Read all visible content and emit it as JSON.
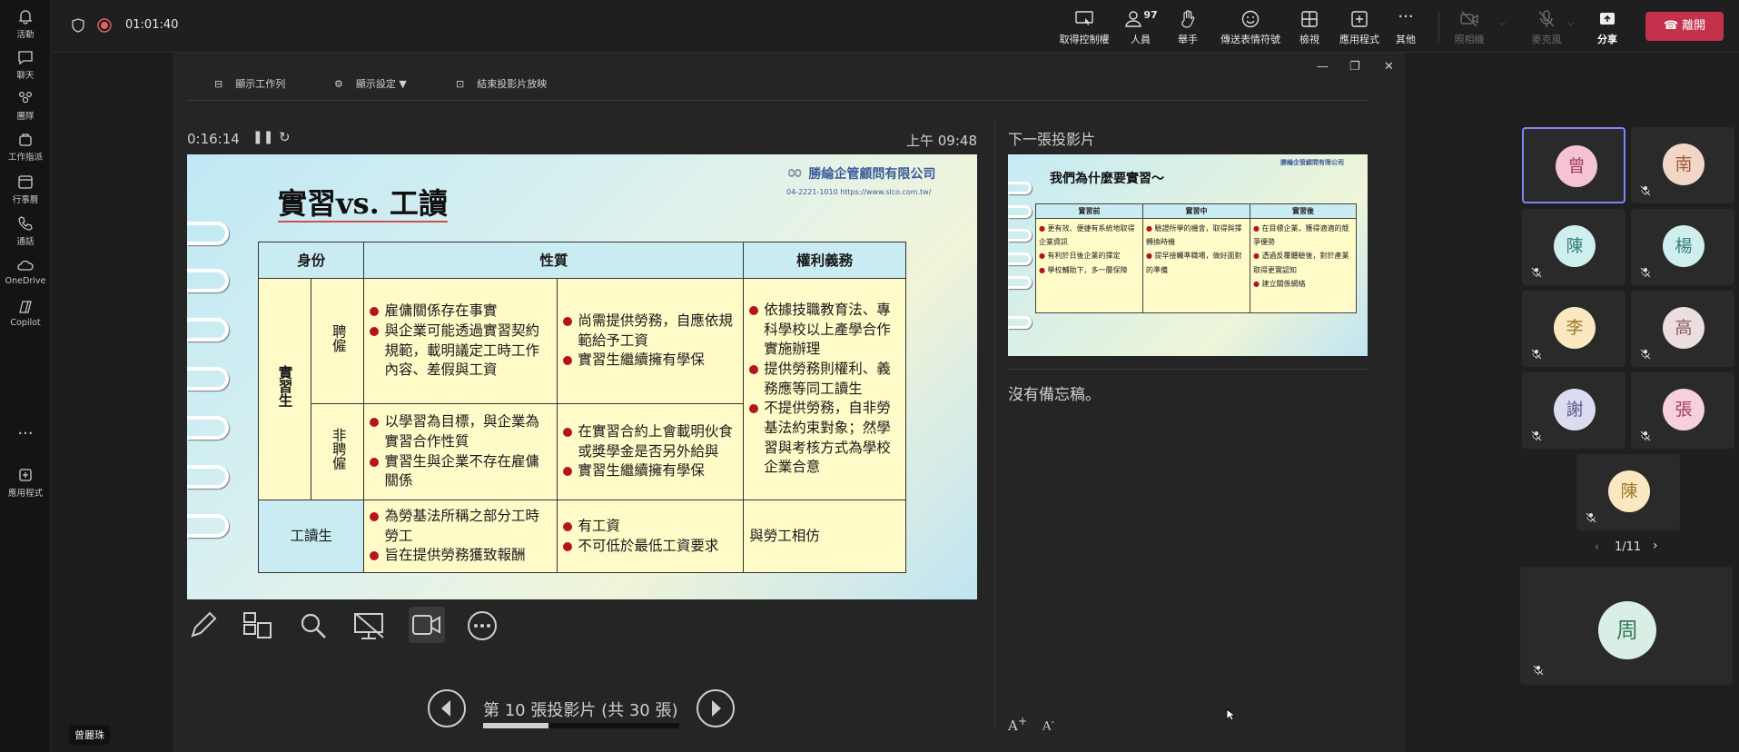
{
  "rail": [
    {
      "label": "活動",
      "icon": "bell-icon"
    },
    {
      "label": "聊天",
      "icon": "chat-icon"
    },
    {
      "label": "團隊",
      "icon": "teams-icon"
    },
    {
      "label": "工作指派",
      "icon": "assignments-icon"
    },
    {
      "label": "行事曆",
      "icon": "calendar-icon"
    },
    {
      "label": "通話",
      "icon": "phone-icon"
    },
    {
      "label": "OneDrive",
      "icon": "cloud-icon"
    },
    {
      "label": "Copilot",
      "icon": "copilot-icon"
    },
    {
      "label": "...",
      "icon": "more-icon"
    },
    {
      "label": "應用程式",
      "icon": "apps-icon"
    }
  ],
  "meeting": {
    "timer": "01:01:40"
  },
  "toolbar": {
    "control": "取得控制權",
    "people": "人員",
    "people_count": "97",
    "raise": "舉手",
    "react": "傳送表情符號",
    "view": "檢視",
    "apps": "應用程式",
    "more": "其他",
    "camera": "照相機",
    "mic": "麥克風",
    "share": "分享",
    "leave": "離開"
  },
  "presenter": {
    "show_taskbar": "顯示工作列",
    "display_settings": "顯示設定 ▼",
    "end_show": "結束投影片放映",
    "elapsed": "0:16:14",
    "clock": "上午 09:48",
    "next_label": "下一張投影片",
    "notes": "沒有備忘稿。",
    "slide_counter": "第 10 張投影片 (共 30 張)",
    "progress": 0.333
  },
  "slide": {
    "title": "實習vs. 工讀",
    "logo": "勝綸企管顧問有限公司",
    "logo_sub": "04-2221-1010  https://www.slco.com.tw/",
    "headers": [
      "身份",
      "性質",
      "權利義務"
    ],
    "row_group": "實習生",
    "row_hire": "聘僱",
    "row_nohire": "非聘僱",
    "row_work": "工讀生",
    "hire_a": [
      "雇傭關係存在事實",
      "與企業可能透過實習契約規範，載明議定工時工作內容、差假與工資"
    ],
    "hire_b": [
      "尚需提供勞務，自應依規範給予工資",
      "實習生繼續擁有學保"
    ],
    "rights": [
      "依據技職教育法、專科學校以上產學合作實施辦理",
      "提供勞務則權利、義務應等同工讀生",
      "不提供勞務，自非勞基法約束對象；然學習與考核方式為學校企業合意"
    ],
    "nohire_a": [
      "以學習為目標，與企業為實習合作性質",
      "實習生與企業不存在雇傭關係"
    ],
    "nohire_b": [
      "在實習合約上會載明伙食或獎學金是否另外給與",
      "實習生繼續擁有學保"
    ],
    "work_a": [
      "為勞基法所稱之部分工時勞工",
      "旨在提供勞務獲致報酬"
    ],
    "work_b": [
      "有工資",
      "不可低於最低工資要求"
    ],
    "work_rights": "與勞工相仿"
  },
  "next_slide": {
    "title": "我們為什麼要實習～",
    "headers": [
      "實習前",
      "實習中",
      "實習後"
    ],
    "col1": [
      "更有效、便捷有系統地取得企業資訊",
      "有利於日後企業的擇定",
      "學校輔助下，多一層保障"
    ],
    "col2": [
      "驗證所學的機會，取得與擇轉換時機",
      "提早接觸準職場，做好面對的準備"
    ],
    "col3": [
      "在目標企業，獲得適適的競爭優勢",
      "透過反覆體驗後，對於產業取得更實認知",
      "建立關係網絡"
    ]
  },
  "participants": [
    {
      "initial": "曾",
      "color": "#f4c4d4",
      "text": "#a0405a",
      "muted": false,
      "active": true
    },
    {
      "initial": "南",
      "color": "#f2d6c8",
      "text": "#a05a40",
      "muted": true
    },
    {
      "initial": "陳",
      "color": "#cfeeee",
      "text": "#3a8080",
      "muted": true
    },
    {
      "initial": "楊",
      "color": "#cfeeee",
      "text": "#3a8080",
      "muted": true
    },
    {
      "initial": "李",
      "color": "#fbe8c0",
      "text": "#a07a30",
      "muted": true
    },
    {
      "initial": "高",
      "color": "#ecdede",
      "text": "#8a5a5a",
      "muted": true
    },
    {
      "initial": "謝",
      "color": "#dcdcf0",
      "text": "#5a5a90",
      "muted": true
    },
    {
      "initial": "張",
      "color": "#f6d0dc",
      "text": "#a04060",
      "muted": true
    },
    {
      "initial": "陳",
      "color": "#fbe8c0",
      "text": "#a07a30",
      "muted": true
    }
  ],
  "pager": "1/11",
  "self": {
    "initial": "周",
    "color": "#d9efe6",
    "text": "#3a7a60"
  },
  "presenter_name": "曾麗珠"
}
